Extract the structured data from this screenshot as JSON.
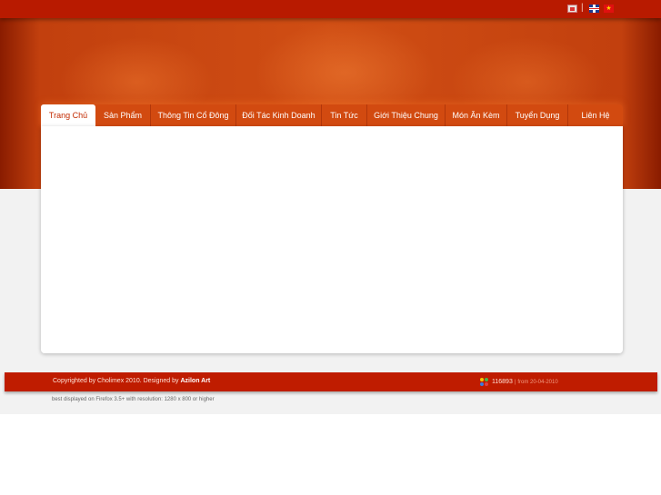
{
  "languages": [
    {
      "name": "sheet-flag-icon"
    },
    {
      "separator": "|"
    },
    {
      "name": "uk-flag-icon"
    },
    {
      "name": "vietnam-flag-icon",
      "glyph": "★"
    }
  ],
  "nav": {
    "items": [
      {
        "label": "Trang Chủ",
        "active": true
      },
      {
        "label": "Sản Phẩm"
      },
      {
        "label": "Thông Tin Cổ Đông"
      },
      {
        "label": "Đối Tác Kinh Doanh"
      },
      {
        "label": "Tin Tức"
      },
      {
        "label": "Giới Thiệu Chung"
      },
      {
        "label": "Món Ăn Kèm"
      },
      {
        "label": "Tuyển Dụng"
      },
      {
        "label": "Liên Hệ"
      }
    ]
  },
  "footer": {
    "copyright_text": "Copyrighted by Cholimex 2010. Designed by ",
    "designer": "Azilon Art",
    "counter_value": "116893",
    "counter_sep": "|",
    "counter_from": "from 20-04-2010",
    "best_display": "best displayed on Firefox 3.5+ with resolution: 1280 x 800 or higher"
  },
  "colors": {
    "topbar": "#b81a00",
    "header": "#d04e14",
    "nav": "#d24a10",
    "footer": "#bf1c00",
    "page_bg": "#f2f2f2"
  }
}
